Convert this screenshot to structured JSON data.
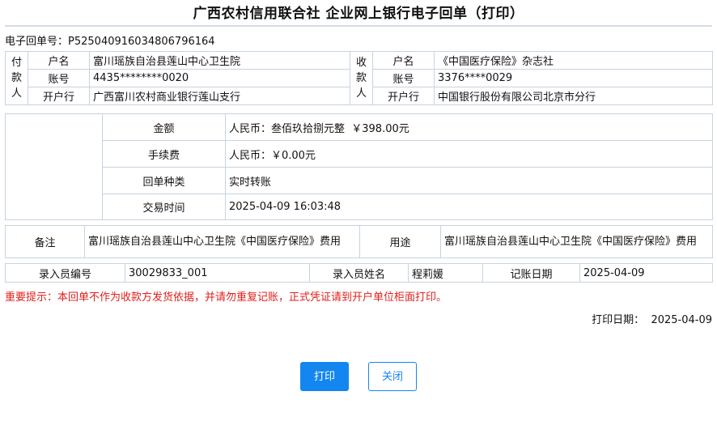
{
  "title": "广西农村信用联合社 企业网上银行电子回单（打印）",
  "receipt": {
    "label": "电子回单号：",
    "value": "P525040916034806796164"
  },
  "payer": {
    "side": [
      "付",
      "款",
      "人"
    ],
    "name_label": "户名",
    "name": "富川瑶族自治县莲山中心卫生院",
    "account_label": "账号",
    "account": "4435********0020",
    "bank_label": "开户行",
    "bank": "广西富川农村商业银行莲山支行"
  },
  "payee": {
    "side": [
      "收",
      "款",
      "人"
    ],
    "name_label": "户名",
    "name": "《中国医疗保险》杂志社",
    "account_label": "账号",
    "account": "3376****0029",
    "bank_label": "开户行",
    "bank": "中国银行股份有限公司北京市分行"
  },
  "amount": {
    "amount_label": "金额",
    "amount": "人民币：叁佰玖拾捌元整  ￥398.00元",
    "fee_label": "手续费",
    "fee": "人民币：￥0.00元",
    "type_label": "回单种类",
    "type": "实时转账",
    "time_label": "交易时间",
    "time": "2025-04-09 16:03:48"
  },
  "remark": {
    "remark_label": "备注",
    "remark": "富川瑶族自治县莲山中心卫生院《中国医疗保险》费用",
    "purpose_label": "用途",
    "purpose": "富川瑶族自治县莲山中心卫生院《中国医疗保险》费用"
  },
  "operator": {
    "id_label": "录入员编号",
    "id": "30029833_001",
    "name_label": "录入员姓名",
    "name": "程莉媛",
    "date_label": "记账日期",
    "date": "2025-04-09"
  },
  "warning": "重要提示：本回单不作为收款方发货依据，并请勿重复记账，正式凭证请到开户单位柜面打印。",
  "print_date": {
    "label": "打印日期：",
    "value": "2025-04-09"
  },
  "buttons": {
    "print": "打印",
    "close": "关闭"
  }
}
